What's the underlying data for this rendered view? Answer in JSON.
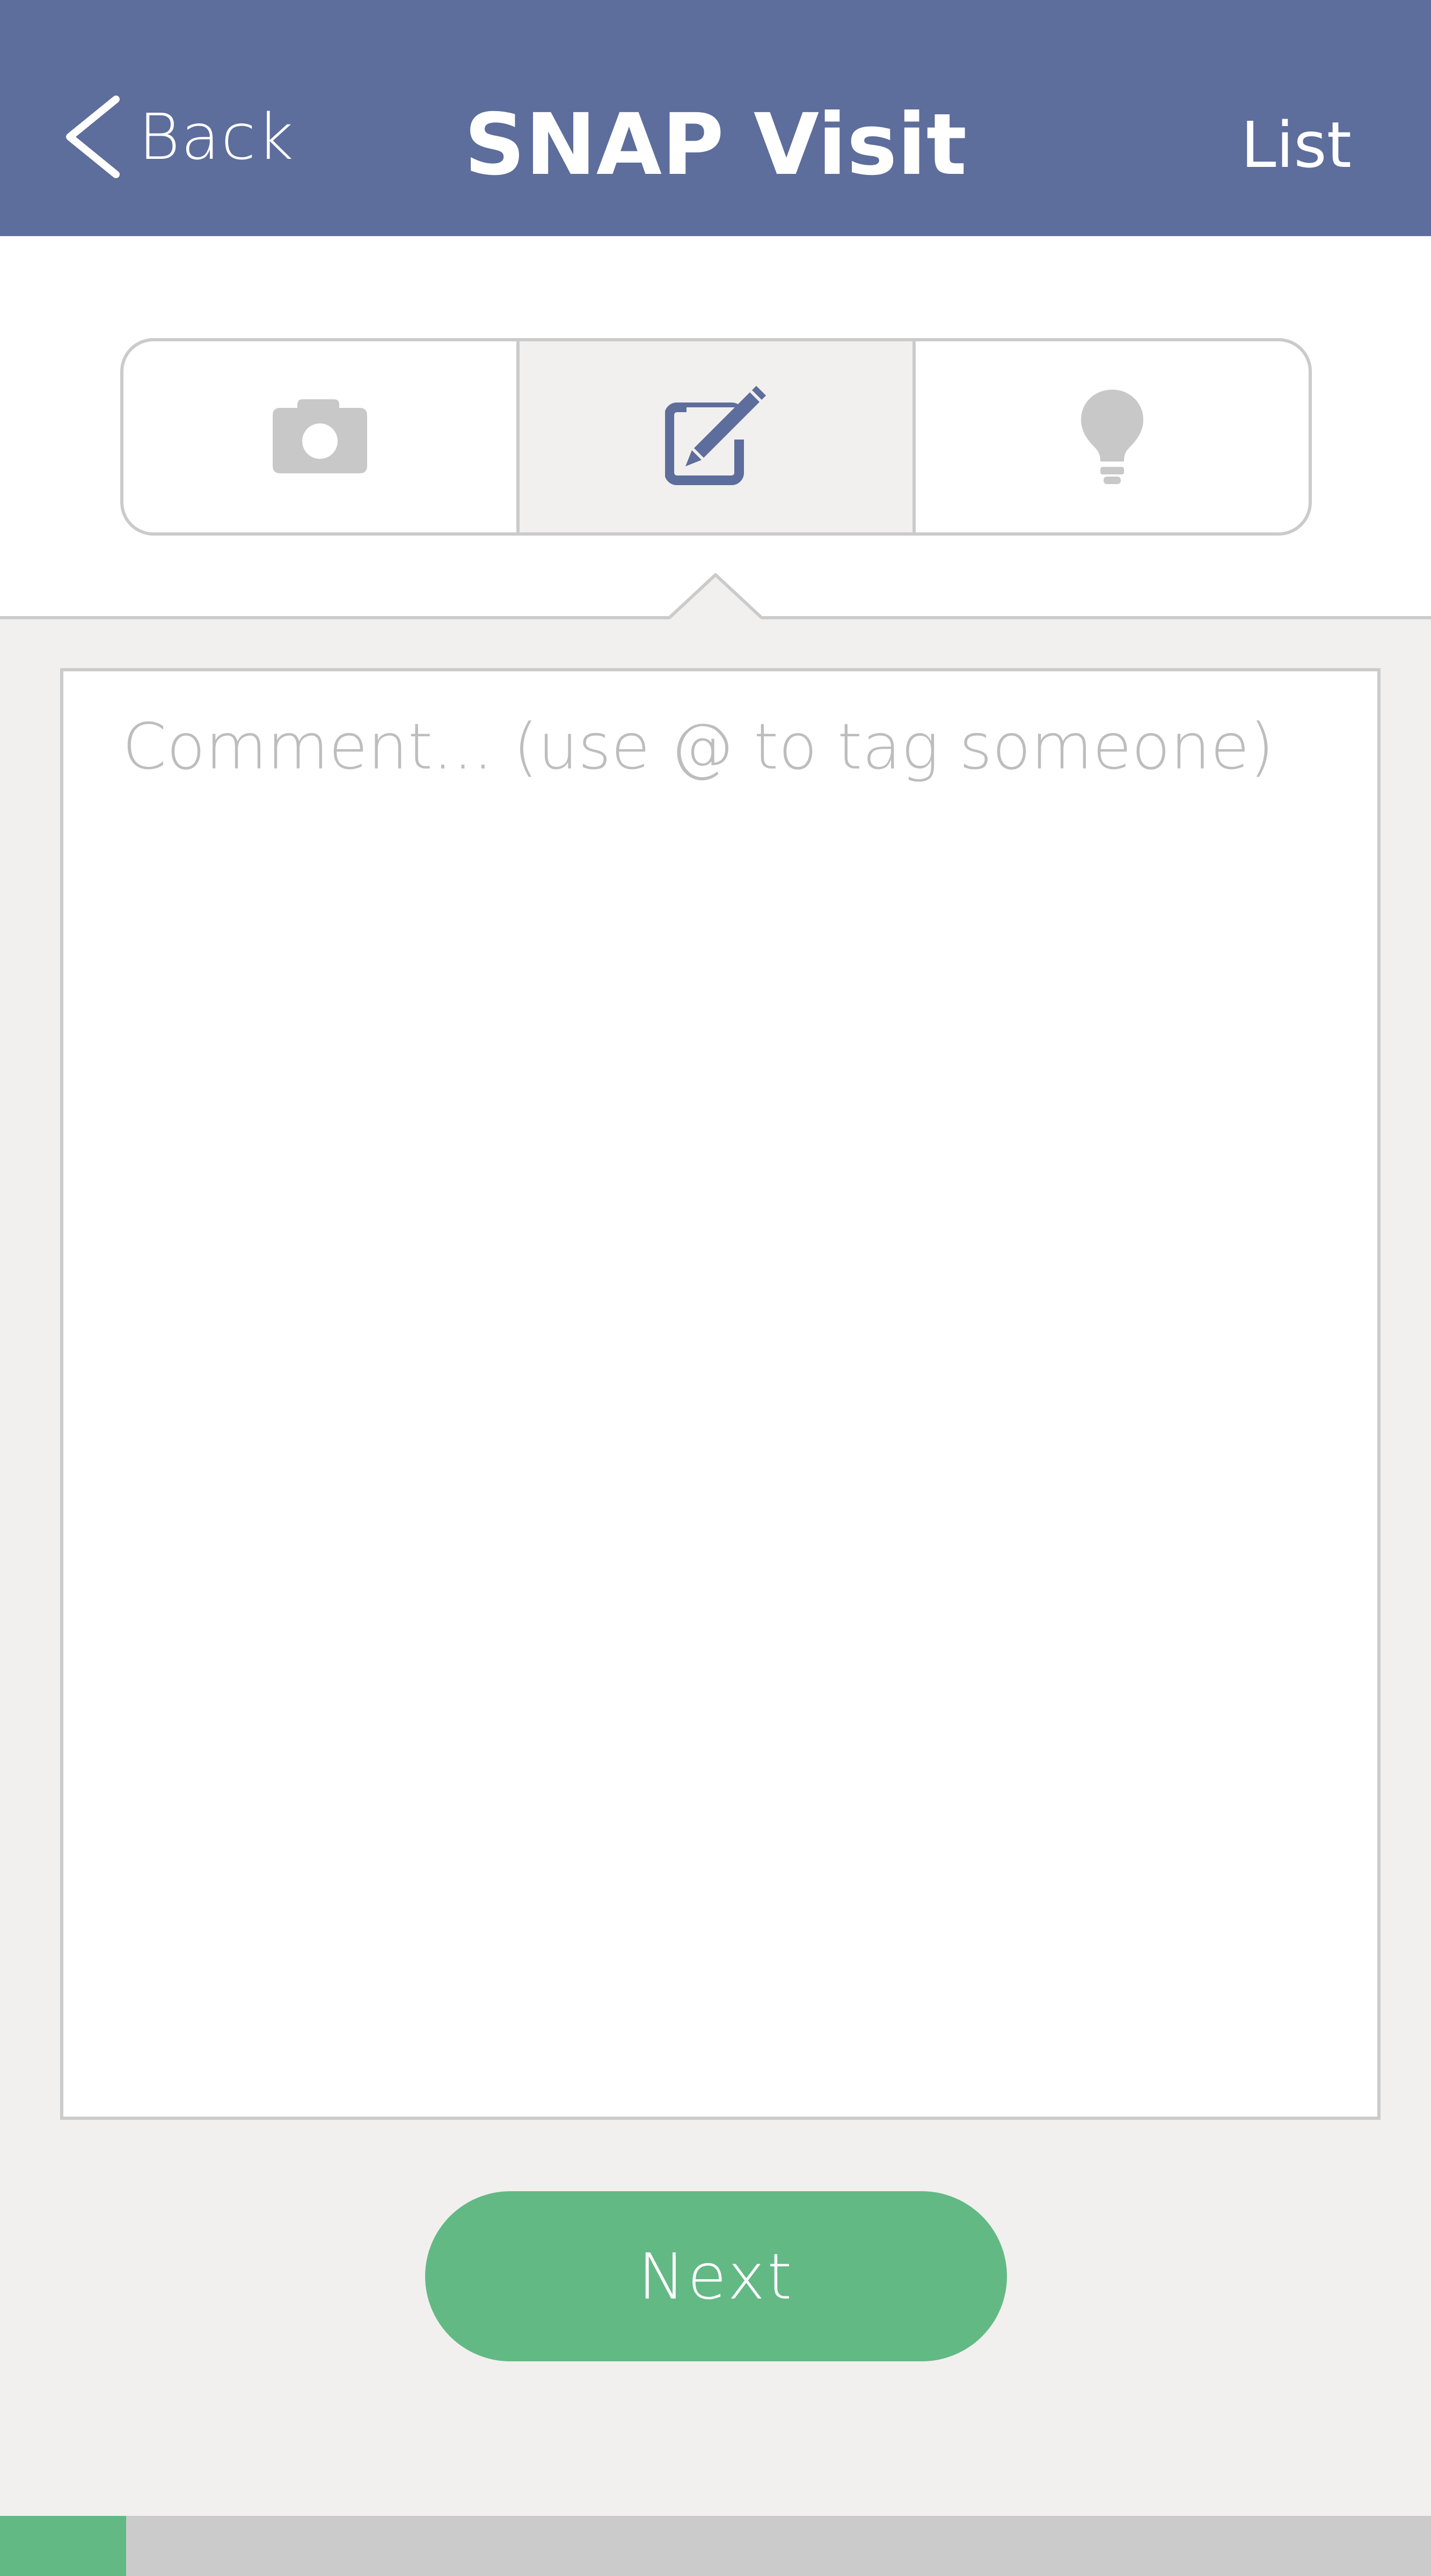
{
  "header": {
    "back_label": "Back",
    "title": "SNAP Visit",
    "list_label": "List",
    "background_color": "#5D6D9C"
  },
  "segments": [
    {
      "icon": "camera-icon",
      "active": false
    },
    {
      "icon": "edit-icon",
      "active": true
    },
    {
      "icon": "lightbulb-icon",
      "active": false
    }
  ],
  "comment": {
    "placeholder": "Comment... (use @ to tag someone)",
    "value": ""
  },
  "next_label": "Next",
  "progress": {
    "fraction": 0.088,
    "fill_color": "#63B984"
  },
  "colors": {
    "accent": "#5D6D9C",
    "primary_button": "#63B984",
    "inactive_icon": "#C8C8C8",
    "panel_background": "#F1F0EE"
  }
}
